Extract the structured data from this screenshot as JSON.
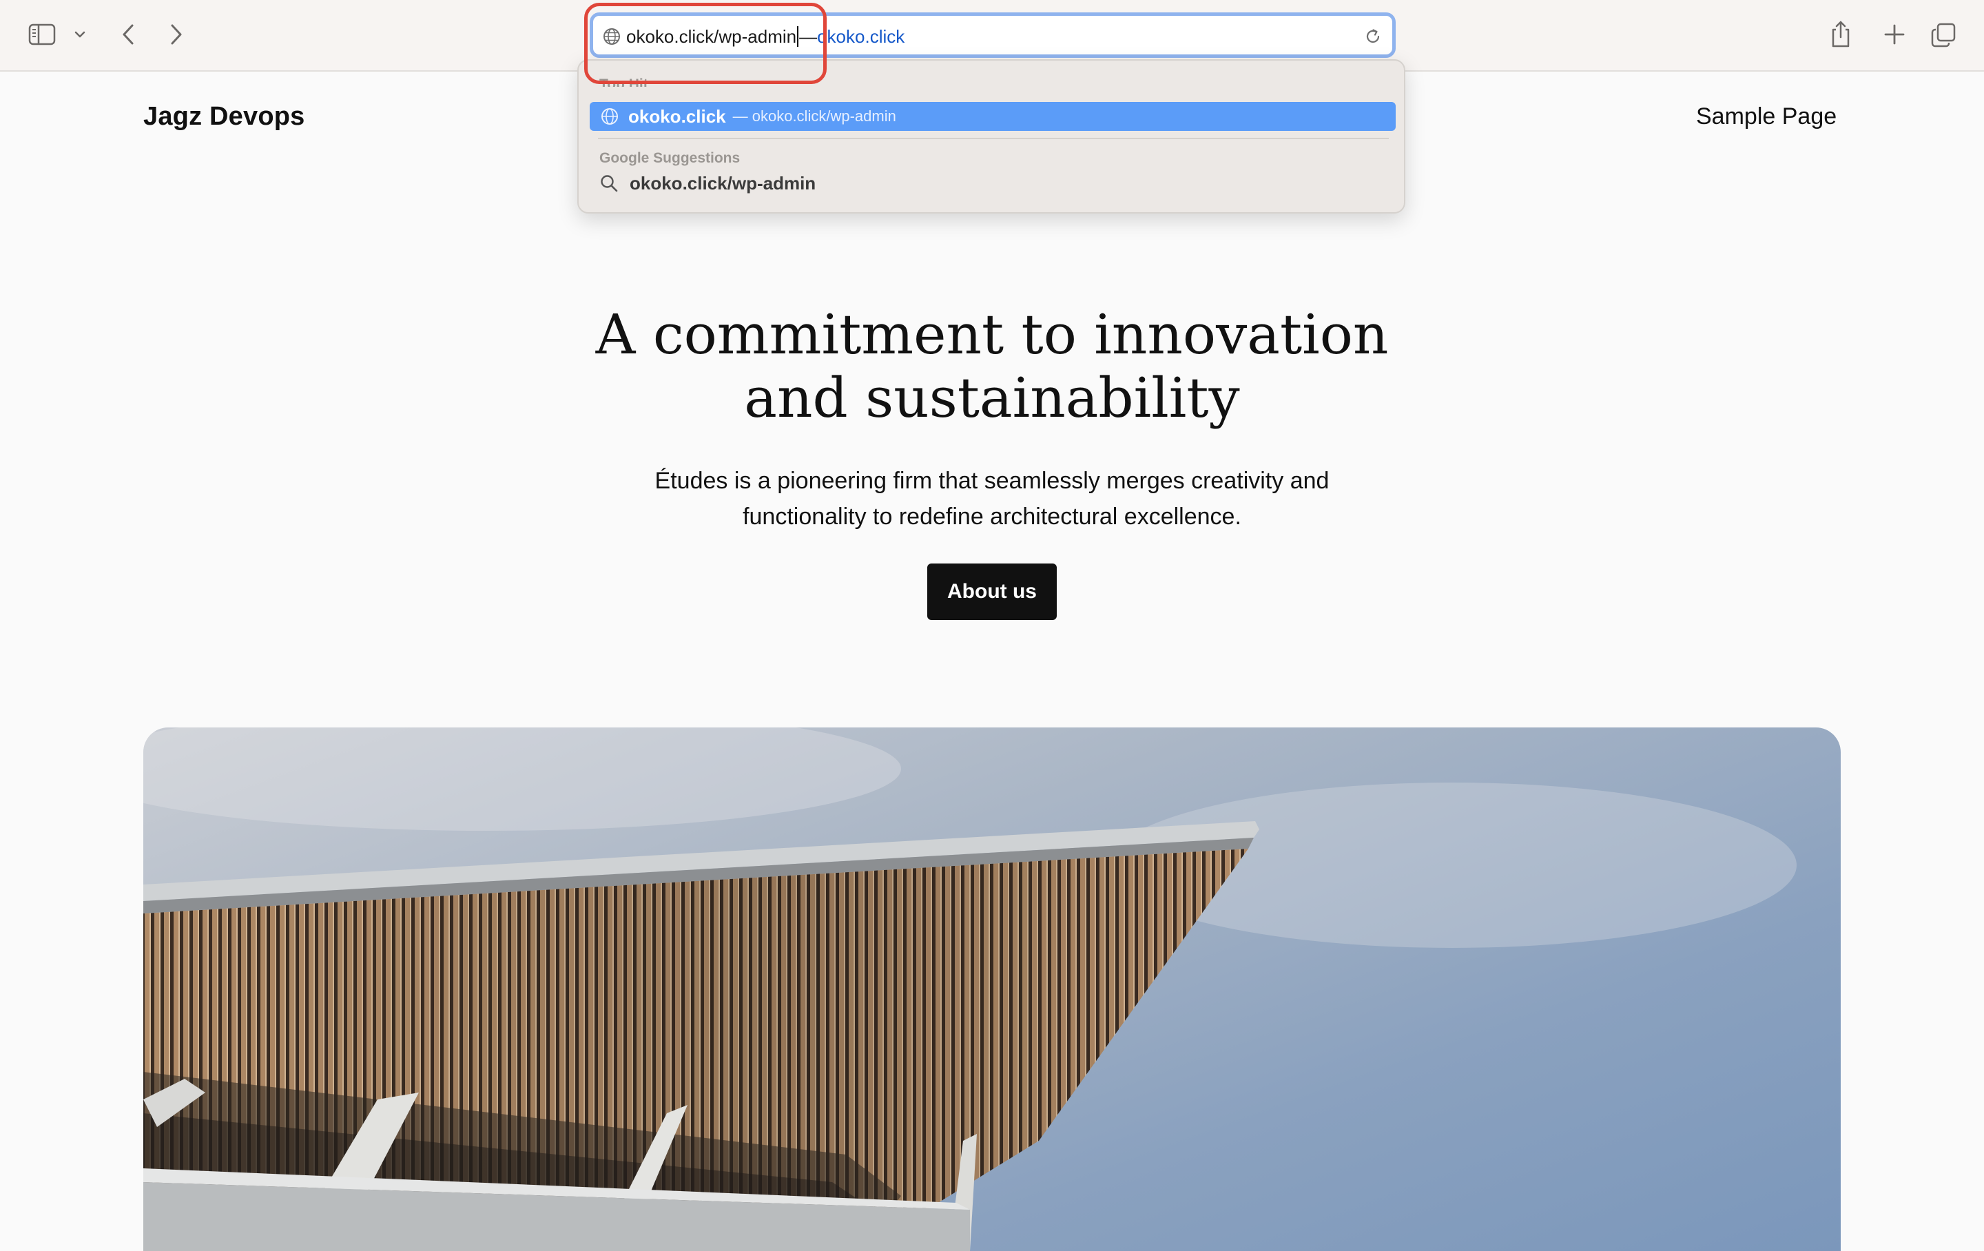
{
  "browser": {
    "address_typed": "okoko.click/wp-admin",
    "address_dash": "—",
    "address_autocomplete": "okoko.click",
    "icons": {
      "sidebar": "sidebar-icon",
      "sidebar_menu": "chevron-down-icon",
      "back": "chevron-left-icon",
      "forward": "chevron-right-icon",
      "site": "globe-icon",
      "reload": "reload-icon",
      "share": "share-icon",
      "new_tab": "plus-icon",
      "tab_overview": "tabs-icon"
    },
    "accent_color": "#5b9cf8",
    "highlight_color": "#e0463a"
  },
  "dropdown": {
    "top_hit_label": "Top Hit",
    "top_hit": {
      "title": "okoko.click",
      "subtitle": "— okoko.click/wp-admin"
    },
    "google_label": "Google Suggestions",
    "google_suggestion": "okoko.click/wp-admin"
  },
  "page": {
    "site_title": "Jagz Devops",
    "nav_link": "Sample Page",
    "heading_line1": "A commitment to innovation",
    "heading_line2": "and sustainability",
    "subtitle_line1": "Études is a pioneering firm that seamlessly merges creativity and",
    "subtitle_line2": "functionality to redefine architectural excellence.",
    "cta_label": "About us"
  }
}
